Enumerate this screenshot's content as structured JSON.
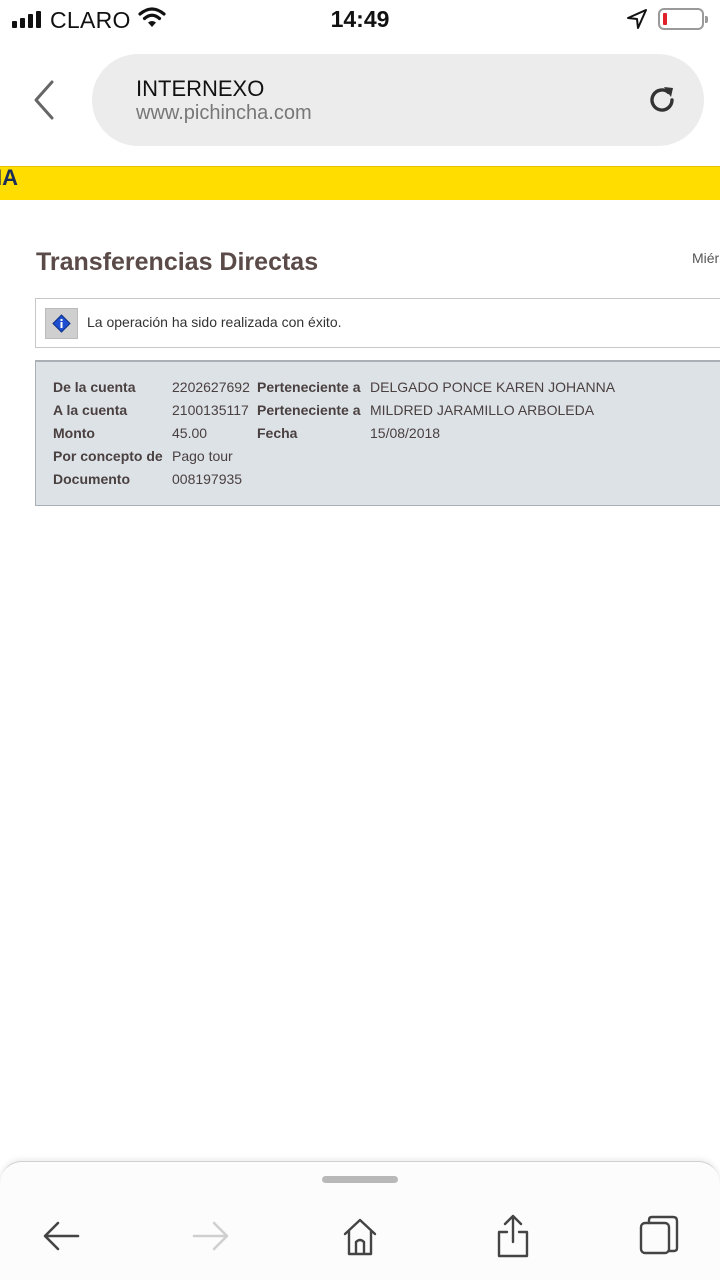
{
  "status_bar": {
    "carrier": "CLARO",
    "time": "14:49"
  },
  "browser": {
    "site_title": "INTERNEXO",
    "site_url": "www.pichincha.com",
    "icons": [
      "back-chevron-icon",
      "reload-icon"
    ]
  },
  "page": {
    "band_text": "IA",
    "title": "Transferencias Directas",
    "date_text": "Miér",
    "info_message": "La operación ha sido realizada con éxito.",
    "details": {
      "from_account_label": "De la cuenta",
      "from_account_value": "2202627692",
      "from_owner_label": "Perteneciente a",
      "from_owner_value": "DELGADO PONCE KAREN JOHANNA",
      "to_account_label": "A la cuenta",
      "to_account_value": "2100135117",
      "to_owner_label": "Perteneciente a",
      "to_owner_value": "MILDRED JARAMILLO ARBOLEDA",
      "amount_label": "Monto",
      "amount_value": "45.00",
      "date_label": "Fecha",
      "date_value": "15/08/2018",
      "concept_label": "Por concepto de",
      "concept_value": "Pago tour",
      "document_label": "Documento",
      "document_value": "008197935"
    }
  },
  "toolbar": {
    "icons": [
      "back-arrow-icon",
      "forward-arrow-icon",
      "home-icon",
      "share-icon",
      "tabs-icon"
    ]
  },
  "colors": {
    "brand_yellow": "#ffdd00",
    "title_brown": "#5a4a48",
    "details_bg": "#dde2e7",
    "info_blue": "#1e4fd0"
  }
}
